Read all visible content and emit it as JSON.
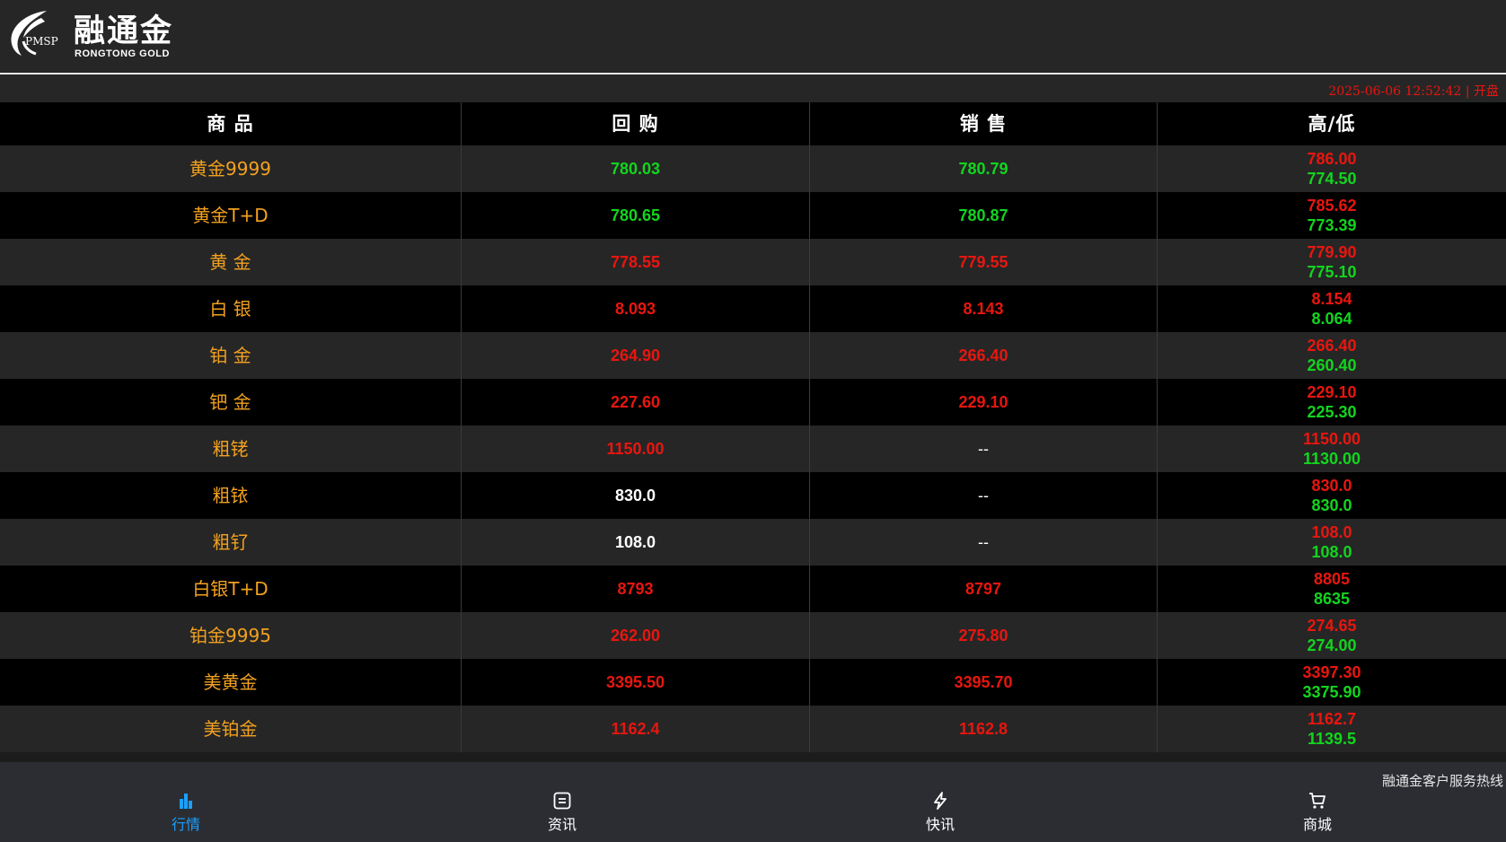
{
  "header": {
    "logo_mark_text": "PMSP",
    "logo_title": "融通金",
    "logo_sub": "RONGTONG  GOLD"
  },
  "status": {
    "text": "2025-06-06 12:52:42 | 开盘"
  },
  "table": {
    "columns": [
      "商 品",
      "回 购",
      "销 售",
      "高/低"
    ],
    "rows": [
      {
        "name": "黄金9999",
        "buy": "780.03",
        "buy_color": "green",
        "sell": "780.79",
        "sell_color": "green",
        "high": "786.00",
        "low": "774.50"
      },
      {
        "name": "黄金T+D",
        "buy": "780.65",
        "buy_color": "green",
        "sell": "780.87",
        "sell_color": "green",
        "high": "785.62",
        "low": "773.39"
      },
      {
        "name": "黄 金",
        "buy": "778.55",
        "buy_color": "red",
        "sell": "779.55",
        "sell_color": "red",
        "high": "779.90",
        "low": "775.10"
      },
      {
        "name": "白 银",
        "buy": "8.093",
        "buy_color": "red",
        "sell": "8.143",
        "sell_color": "red",
        "high": "8.154",
        "low": "8.064"
      },
      {
        "name": "铂 金",
        "buy": "264.90",
        "buy_color": "red",
        "sell": "266.40",
        "sell_color": "red",
        "high": "266.40",
        "low": "260.40"
      },
      {
        "name": "钯 金",
        "buy": "227.60",
        "buy_color": "red",
        "sell": "229.10",
        "sell_color": "red",
        "high": "229.10",
        "low": "225.30"
      },
      {
        "name": "粗铑",
        "buy": "1150.00",
        "buy_color": "red",
        "sell": "--",
        "sell_color": "dash",
        "high": "1150.00",
        "low": "1130.00"
      },
      {
        "name": "粗铱",
        "buy": "830.0",
        "buy_color": "white",
        "sell": "--",
        "sell_color": "dash",
        "high": "830.0",
        "low": "830.0"
      },
      {
        "name": "粗钌",
        "buy": "108.0",
        "buy_color": "white",
        "sell": "--",
        "sell_color": "dash",
        "high": "108.0",
        "low": "108.0"
      },
      {
        "name": "白银T+D",
        "buy": "8793",
        "buy_color": "red",
        "sell": "8797",
        "sell_color": "red",
        "high": "8805",
        "low": "8635"
      },
      {
        "name": "铂金9995",
        "buy": "262.00",
        "buy_color": "red",
        "sell": "275.80",
        "sell_color": "red",
        "high": "274.65",
        "low": "274.00"
      },
      {
        "name": "美黄金",
        "buy": "3395.50",
        "buy_color": "red",
        "sell": "3395.70",
        "sell_color": "red",
        "high": "3397.30",
        "low": "3375.90"
      },
      {
        "name": "美铂金",
        "buy": "1162.4",
        "buy_color": "red",
        "sell": "1162.8",
        "sell_color": "red",
        "high": "1162.7",
        "low": "1139.5"
      }
    ]
  },
  "footer": {
    "marquee": "融通金客户服务热线",
    "nav": [
      {
        "label": "行情",
        "icon": "bar-chart-icon",
        "active": true
      },
      {
        "label": "资讯",
        "icon": "news-icon",
        "active": false
      },
      {
        "label": "快讯",
        "icon": "lightning-icon",
        "active": false
      },
      {
        "label": "商城",
        "icon": "cart-icon",
        "active": false
      }
    ]
  },
  "colors": {
    "red": "#e8160f",
    "green": "#12d51e",
    "name": "#f2a11f",
    "active": "#1aa0ff",
    "footer_bg": "#2b2d33"
  }
}
